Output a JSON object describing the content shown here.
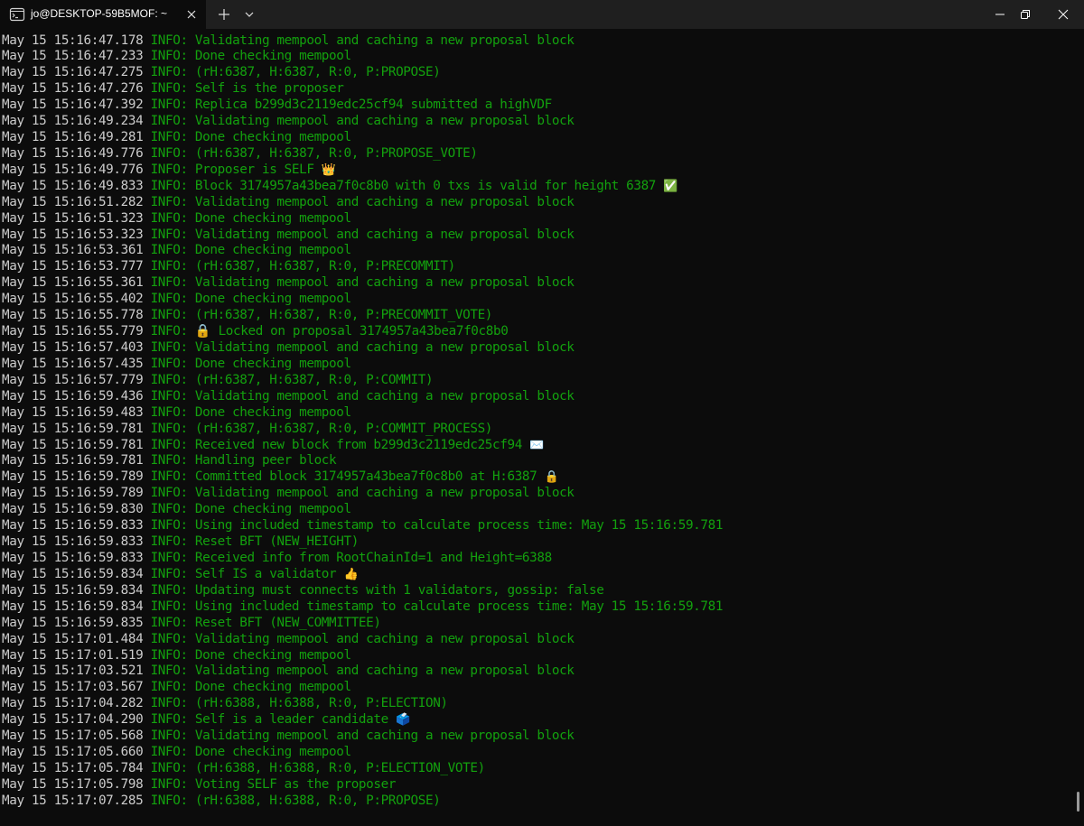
{
  "window": {
    "tab_title": "jo@DESKTOP-59B5MOF: ~"
  },
  "terminal": {
    "lines": [
      {
        "ts": "May 15 15:16:47.178",
        "msg": "INFO: Validating mempool and caching a new proposal block",
        "emoji": ""
      },
      {
        "ts": "May 15 15:16:47.233",
        "msg": "INFO: Done checking mempool",
        "emoji": ""
      },
      {
        "ts": "May 15 15:16:47.275",
        "msg": "INFO: (rH:6387, H:6387, R:0, P:PROPOSE)",
        "emoji": ""
      },
      {
        "ts": "May 15 15:16:47.276",
        "msg": "INFO: Self is the proposer",
        "emoji": ""
      },
      {
        "ts": "May 15 15:16:47.392",
        "msg": "INFO: Replica b299d3c2119edc25cf94 submitted a highVDF",
        "emoji": ""
      },
      {
        "ts": "May 15 15:16:49.234",
        "msg": "INFO: Validating mempool and caching a new proposal block",
        "emoji": ""
      },
      {
        "ts": "May 15 15:16:49.281",
        "msg": "INFO: Done checking mempool",
        "emoji": ""
      },
      {
        "ts": "May 15 15:16:49.776",
        "msg": "INFO: (rH:6387, H:6387, R:0, P:PROPOSE_VOTE)",
        "emoji": ""
      },
      {
        "ts": "May 15 15:16:49.776",
        "msg": "INFO: Proposer is SELF ",
        "emoji": "👑"
      },
      {
        "ts": "May 15 15:16:49.833",
        "msg": "INFO: Block 3174957a43bea7f0c8b0 with 0 txs is valid for height 6387 ",
        "emoji": "✅"
      },
      {
        "ts": "May 15 15:16:51.282",
        "msg": "INFO: Validating mempool and caching a new proposal block",
        "emoji": ""
      },
      {
        "ts": "May 15 15:16:51.323",
        "msg": "INFO: Done checking mempool",
        "emoji": ""
      },
      {
        "ts": "May 15 15:16:53.323",
        "msg": "INFO: Validating mempool and caching a new proposal block",
        "emoji": ""
      },
      {
        "ts": "May 15 15:16:53.361",
        "msg": "INFO: Done checking mempool",
        "emoji": ""
      },
      {
        "ts": "May 15 15:16:53.777",
        "msg": "INFO: (rH:6387, H:6387, R:0, P:PRECOMMIT)",
        "emoji": ""
      },
      {
        "ts": "May 15 15:16:55.361",
        "msg": "INFO: Validating mempool and caching a new proposal block",
        "emoji": ""
      },
      {
        "ts": "May 15 15:16:55.402",
        "msg": "INFO: Done checking mempool",
        "emoji": ""
      },
      {
        "ts": "May 15 15:16:55.778",
        "msg": "INFO: (rH:6387, H:6387, R:0, P:PRECOMMIT_VOTE)",
        "emoji": ""
      },
      {
        "ts": "May 15 15:16:55.779",
        "msg": "INFO: 🔒 Locked on proposal 3174957a43bea7f0c8b0",
        "emoji": ""
      },
      {
        "ts": "May 15 15:16:57.403",
        "msg": "INFO: Validating mempool and caching a new proposal block",
        "emoji": ""
      },
      {
        "ts": "May 15 15:16:57.435",
        "msg": "INFO: Done checking mempool",
        "emoji": ""
      },
      {
        "ts": "May 15 15:16:57.779",
        "msg": "INFO: (rH:6387, H:6387, R:0, P:COMMIT)",
        "emoji": ""
      },
      {
        "ts": "May 15 15:16:59.436",
        "msg": "INFO: Validating mempool and caching a new proposal block",
        "emoji": ""
      },
      {
        "ts": "May 15 15:16:59.483",
        "msg": "INFO: Done checking mempool",
        "emoji": ""
      },
      {
        "ts": "May 15 15:16:59.781",
        "msg": "INFO: (rH:6387, H:6387, R:0, P:COMMIT_PROCESS)",
        "emoji": ""
      },
      {
        "ts": "May 15 15:16:59.781",
        "msg": "INFO: Received new block from b299d3c2119edc25cf94 ",
        "emoji": "✉️"
      },
      {
        "ts": "May 15 15:16:59.781",
        "msg": "INFO: Handling peer block",
        "emoji": ""
      },
      {
        "ts": "May 15 15:16:59.789",
        "msg": "INFO: Committed block 3174957a43bea7f0c8b0 at H:6387 ",
        "emoji": "🔒"
      },
      {
        "ts": "May 15 15:16:59.789",
        "msg": "INFO: Validating mempool and caching a new proposal block",
        "emoji": ""
      },
      {
        "ts": "May 15 15:16:59.830",
        "msg": "INFO: Done checking mempool",
        "emoji": ""
      },
      {
        "ts": "May 15 15:16:59.833",
        "msg": "INFO: Using included timestamp to calculate process time: May 15 15:16:59.781",
        "emoji": ""
      },
      {
        "ts": "May 15 15:16:59.833",
        "msg": "INFO: Reset BFT (NEW_HEIGHT)",
        "emoji": ""
      },
      {
        "ts": "May 15 15:16:59.833",
        "msg": "INFO: Received info from RootChainId=1 and Height=6388",
        "emoji": ""
      },
      {
        "ts": "May 15 15:16:59.834",
        "msg": "INFO: Self IS a validator ",
        "emoji": "👍"
      },
      {
        "ts": "May 15 15:16:59.834",
        "msg": "INFO: Updating must connects with 1 validators, gossip: false",
        "emoji": ""
      },
      {
        "ts": "May 15 15:16:59.834",
        "msg": "INFO: Using included timestamp to calculate process time: May 15 15:16:59.781",
        "emoji": ""
      },
      {
        "ts": "May 15 15:16:59.835",
        "msg": "INFO: Reset BFT (NEW_COMMITTEE)",
        "emoji": ""
      },
      {
        "ts": "May 15 15:17:01.484",
        "msg": "INFO: Validating mempool and caching a new proposal block",
        "emoji": ""
      },
      {
        "ts": "May 15 15:17:01.519",
        "msg": "INFO: Done checking mempool",
        "emoji": ""
      },
      {
        "ts": "May 15 15:17:03.521",
        "msg": "INFO: Validating mempool and caching a new proposal block",
        "emoji": ""
      },
      {
        "ts": "May 15 15:17:03.567",
        "msg": "INFO: Done checking mempool",
        "emoji": ""
      },
      {
        "ts": "May 15 15:17:04.282",
        "msg": "INFO: (rH:6388, H:6388, R:0, P:ELECTION)",
        "emoji": ""
      },
      {
        "ts": "May 15 15:17:04.290",
        "msg": "INFO: Self is a leader candidate ",
        "emoji": "🗳️"
      },
      {
        "ts": "May 15 15:17:05.568",
        "msg": "INFO: Validating mempool and caching a new proposal block",
        "emoji": ""
      },
      {
        "ts": "May 15 15:17:05.660",
        "msg": "INFO: Done checking mempool",
        "emoji": ""
      },
      {
        "ts": "May 15 15:17:05.784",
        "msg": "INFO: (rH:6388, H:6388, R:0, P:ELECTION_VOTE)",
        "emoji": ""
      },
      {
        "ts": "May 15 15:17:05.798",
        "msg": "INFO: Voting SELF as the proposer",
        "emoji": ""
      },
      {
        "ts": "May 15 15:17:07.285",
        "msg": "INFO: (rH:6388, H:6388, R:0, P:PROPOSE)",
        "emoji": ""
      }
    ]
  }
}
